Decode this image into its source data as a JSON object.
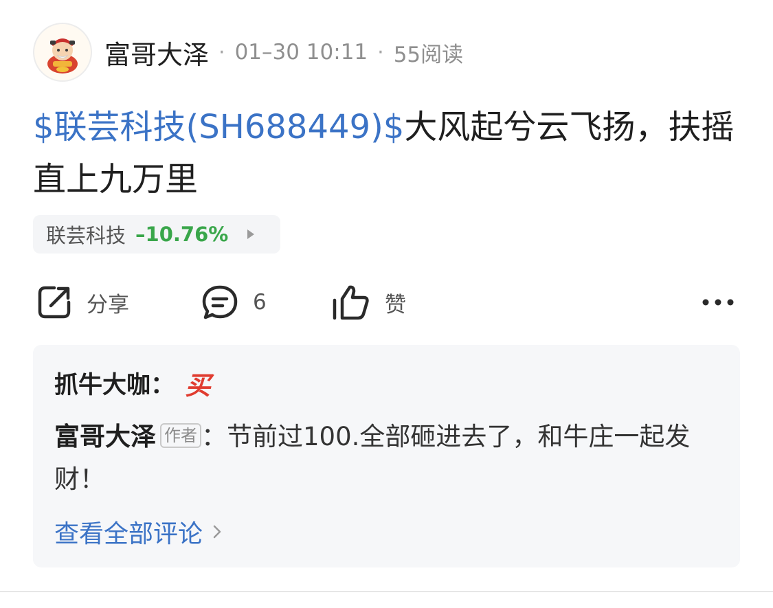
{
  "header": {
    "author": "富哥大泽",
    "separator": "·",
    "time": "01–30 10:11",
    "reads": "55阅读"
  },
  "post": {
    "stock_tag": "$联芸科技(SH688449)$",
    "text": "大风起兮云飞扬，扶摇直上九万里"
  },
  "stock_chip": {
    "name": "联芸科技",
    "change": "–10.76%",
    "change_color": "#39a64a"
  },
  "actions": {
    "share_label": "分享",
    "comment_count": "6",
    "like_label": "赞",
    "more_icon": "more-dots-icon"
  },
  "panel": {
    "title": "抓牛大咖：",
    "badge": "买",
    "badge_color": "#e03c30",
    "comment_author": "富哥大泽",
    "author_tag": "作者",
    "colon": "：",
    "comment_text": "节前过100.全部砸进去了，和牛庄一起发财！",
    "view_all": "查看全部评论"
  },
  "colors": {
    "link": "#3b73c6",
    "panel_bg": "#f6f7f9"
  }
}
